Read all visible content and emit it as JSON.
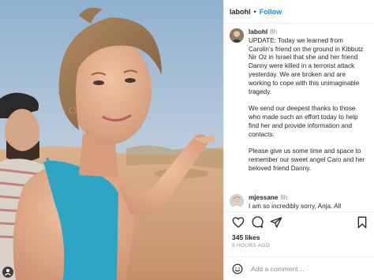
{
  "header": {
    "username": "labohl",
    "separator": "•",
    "follow_label": "Follow"
  },
  "caption": {
    "username": "labohl",
    "time": "8h",
    "paragraphs": [
      "UPDATE: Today we learned from Carolin's friend on the ground in Kibbutz Nir Oz in Israel that she and her friend Danny were killed in a terrorist attack yesterday. We are broken and are working to cope with this unimaginable tragedy.",
      "We send our deepest thanks to those who made such an effort today to help find her and provide information and contacts.",
      "Please give us some time and space to remember our sweet angel Caro and her beloved friend Danny."
    ]
  },
  "comment": {
    "username": "mjessane",
    "time": "8h",
    "text": "I am so incredibly sorry, Anja. All"
  },
  "actions": {
    "icons": [
      "heart-icon",
      "comment-icon",
      "share-icon",
      "bookmark-icon"
    ]
  },
  "likes": "345 likes",
  "time_ago": "8 HOURS AGO",
  "add_comment": {
    "placeholder": "Add a comment…",
    "icon": "emoji-icon"
  }
}
